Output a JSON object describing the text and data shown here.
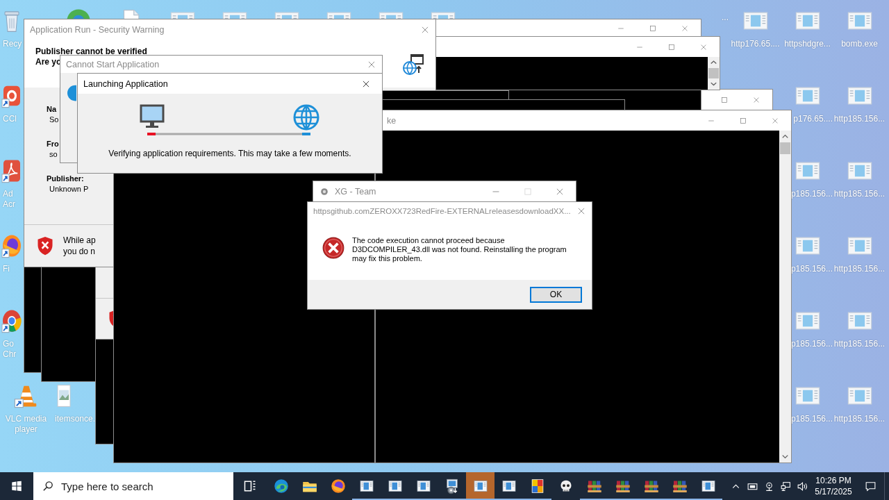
{
  "desktop_icons": [
    {
      "kind": "recycle-bin",
      "label": [
        "Recy"
      ]
    },
    {
      "kind": "round-app"
    },
    {
      "kind": "document"
    },
    {
      "kind": "window-file"
    },
    {
      "kind": "window-file"
    },
    {
      "kind": "window-file"
    },
    {
      "kind": "window-file"
    },
    {
      "kind": "window-file"
    },
    {
      "kind": "window-file"
    },
    {
      "label": [
        "..."
      ]
    },
    {
      "kind": "window-file",
      "label": [
        "http176.65...."
      ]
    },
    {
      "kind": "window-file",
      "label": [
        "httpshdgre..."
      ]
    },
    {
      "kind": "window-file",
      "label": [
        "bomb.exe"
      ]
    },
    {
      "kind": "shortcut-app",
      "label": [
        "CCl"
      ]
    },
    {
      "kind": "window-file",
      "label": [
        "p176.65...."
      ]
    },
    {
      "kind": "window-file",
      "label": [
        "http185.156..."
      ]
    },
    {
      "kind": "acrobat",
      "label": [
        "Ad",
        "Acr"
      ]
    },
    {
      "kind": "window-file",
      "label": [
        "p185.156..."
      ]
    },
    {
      "kind": "window-file",
      "label": [
        "http185.156..."
      ]
    },
    {
      "kind": "firefox",
      "label": [
        "Fi"
      ]
    },
    {
      "kind": "window-file",
      "label": [
        "p185.156..."
      ]
    },
    {
      "kind": "window-file",
      "label": [
        "http185.156..."
      ]
    },
    {
      "kind": "chrome",
      "label": [
        "Go",
        "Chr"
      ]
    },
    {
      "kind": "window-file",
      "label": [
        "p185.156..."
      ]
    },
    {
      "kind": "window-file",
      "label": [
        "http185.156..."
      ]
    },
    {
      "kind": "vlc",
      "label": [
        "VLC media",
        "player"
      ]
    },
    {
      "kind": "image-file",
      "label": [
        "itemsonce."
      ]
    },
    {
      "kind": "window-file",
      "label": [
        "p185.156..."
      ]
    },
    {
      "kind": "window-file",
      "label": [
        "http185.156..."
      ]
    }
  ],
  "windows": [
    {
      "kind": "console",
      "controls": [
        {
          "kind": "maximize"
        },
        {
          "kind": "close"
        }
      ]
    },
    {
      "kind": "console",
      "controls": [
        {
          "kind": "minimize"
        },
        {
          "kind": "maximize"
        },
        {
          "kind": "close"
        }
      ]
    },
    {
      "kind": "console",
      "scrollbar": true,
      "controls": [
        {
          "kind": "minimize"
        },
        {
          "kind": "maximize"
        },
        {
          "kind": "close"
        }
      ]
    },
    {
      "kind": "console"
    },
    {
      "kind": "console"
    },
    {
      "kind": "console"
    },
    {
      "kind": "security-panel"
    },
    {
      "kind": "security-warning",
      "title": "Application Run - Security Warning",
      "active": false,
      "heading": "Publisher cannot be verified",
      "question": "Are yo",
      "fields": [
        {
          "label": "Na",
          "value": "So"
        },
        {
          "label": "Fro",
          "value": "so"
        },
        {
          "label": "Publisher:",
          "value": "Unknown P"
        }
      ],
      "warning": [
        "While ap",
        "you do n"
      ],
      "controls": [
        {
          "kind": "close"
        }
      ]
    },
    {
      "kind": "console"
    },
    {
      "kind": "console"
    },
    {
      "kind": "console"
    },
    {
      "kind": "console",
      "title": "ke",
      "active": false,
      "scrollbar": true,
      "controls": [
        {
          "kind": "minimize"
        },
        {
          "kind": "maximize"
        },
        {
          "kind": "close"
        }
      ]
    },
    {
      "kind": "message",
      "title": "Cannot Start Application",
      "active": false,
      "controls": [
        {
          "kind": "close"
        }
      ]
    },
    {
      "kind": "launching",
      "title": "Launching Application",
      "active": true,
      "message": "Verifying application requirements. This may take a few moments.",
      "controls": [
        {
          "kind": "close"
        }
      ]
    },
    {
      "kind": "app",
      "title": "XG - Team",
      "active": false,
      "controls": [
        {
          "kind": "minimize",
          "disabled": false
        },
        {
          "kind": "maximize",
          "disabled": true
        },
        {
          "kind": "close",
          "disabled": false
        }
      ]
    },
    {
      "kind": "error",
      "title": "httpsgithub.comZEROXX723RedFire-EXTERNALreleasesdownloadXX...",
      "active": false,
      "message": "The code execution cannot proceed because D3DCOMPILER_43.dll was not found. Reinstalling the program may fix this problem.",
      "buttons": [
        {
          "label": "OK",
          "focused": true
        }
      ],
      "controls": [
        {
          "kind": "close"
        }
      ]
    }
  ],
  "taskbar": {
    "search": {
      "placeholder": "Type here to search"
    },
    "apps": [
      {
        "kind": "task-view",
        "running": false,
        "selected": false
      },
      {
        "kind": "edge",
        "running": false,
        "selected": false
      },
      {
        "kind": "explorer",
        "running": false,
        "selected": false
      },
      {
        "kind": "firefox",
        "running": false,
        "selected": false
      },
      {
        "kind": "window",
        "running": true,
        "selected": false
      },
      {
        "kind": "window",
        "running": true,
        "selected": false
      },
      {
        "kind": "window",
        "running": true,
        "selected": false
      },
      {
        "kind": "installer",
        "running": true,
        "selected": false
      },
      {
        "kind": "window",
        "running": true,
        "selected": true
      },
      {
        "kind": "window",
        "running": true,
        "selected": false
      },
      {
        "kind": "paint",
        "running": true,
        "selected": false
      },
      {
        "kind": "skull",
        "running": false,
        "selected": false
      },
      {
        "kind": "archive",
        "running": true,
        "selected": false
      },
      {
        "kind": "archive",
        "running": true,
        "selected": false
      },
      {
        "kind": "archive",
        "running": true,
        "selected": false
      },
      {
        "kind": "archive",
        "running": true,
        "selected": false
      },
      {
        "kind": "window",
        "running": true,
        "selected": false
      }
    ],
    "tray": [
      {
        "kind": "chevron"
      },
      {
        "kind": "keyboard"
      },
      {
        "kind": "camera"
      },
      {
        "kind": "network"
      },
      {
        "kind": "volume"
      }
    ],
    "time": "10:26 PM",
    "date": "5/17/2025"
  }
}
